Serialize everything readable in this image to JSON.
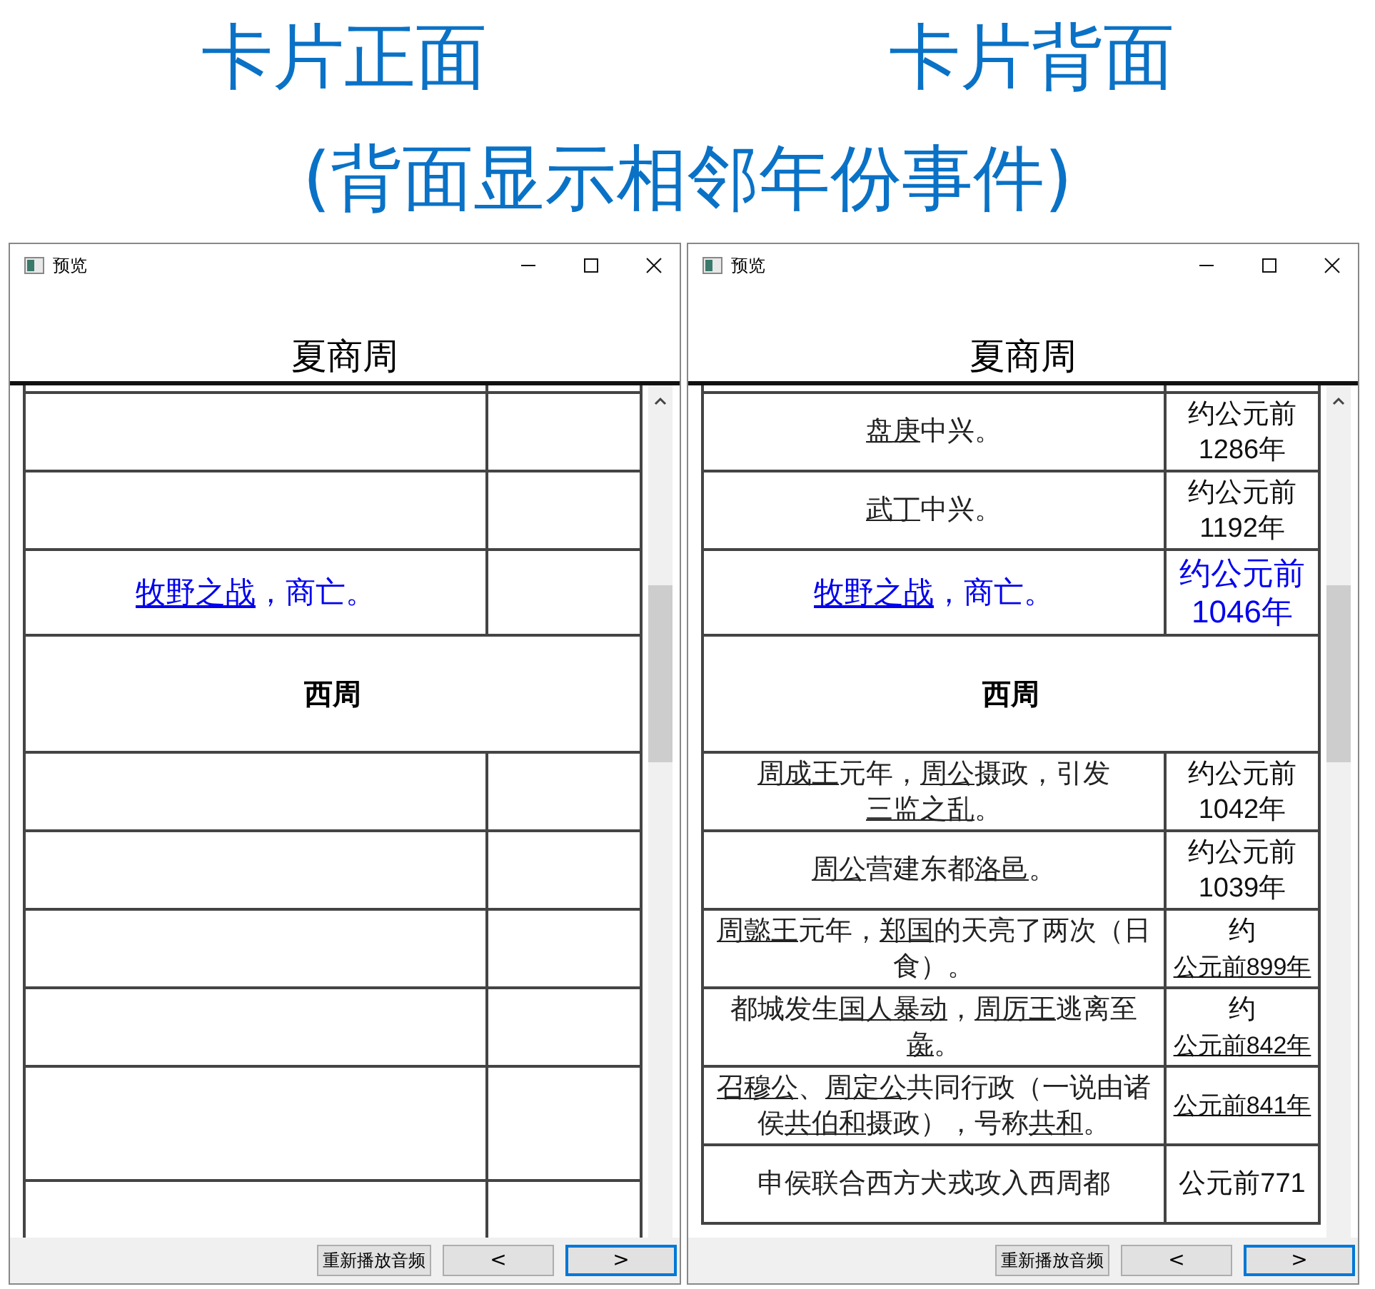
{
  "captions": {
    "front": "卡片正面",
    "back": "卡片背面",
    "note": "(背面显示相邻年份事件)"
  },
  "windows": [
    {
      "title": "预览",
      "heading": "夏商周",
      "rows": [
        {
          "kind": "blank"
        },
        {
          "kind": "blank"
        },
        {
          "kind": "event",
          "current": true,
          "event": [
            {
              "text": "牧野之战",
              "link": true
            },
            {
              "text": "，商亡。",
              "link": false
            }
          ]
        },
        {
          "kind": "period",
          "text": "西周"
        },
        {
          "kind": "blank"
        },
        {
          "kind": "blank"
        },
        {
          "kind": "blank"
        },
        {
          "kind": "blank"
        },
        {
          "kind": "blank",
          "tall": true
        },
        {
          "kind": "blank"
        }
      ],
      "buttons": {
        "replay": "重新播放音频",
        "prev": "<",
        "next": ">"
      }
    },
    {
      "title": "预览",
      "heading": "夏商周",
      "rows": [
        {
          "kind": "event",
          "current": false,
          "event": [
            {
              "text": "盘庚",
              "link": true
            },
            {
              "text": "中兴。",
              "link": false
            }
          ],
          "date": [
            {
              "text": "约公元前1286年",
              "link": false
            }
          ]
        },
        {
          "kind": "event",
          "current": false,
          "event": [
            {
              "text": "武丁",
              "link": true
            },
            {
              "text": "中兴。",
              "link": false
            }
          ],
          "date": [
            {
              "text": "约公元前1192年",
              "link": false
            }
          ]
        },
        {
          "kind": "event",
          "current": true,
          "event": [
            {
              "text": "牧野之战",
              "link": true
            },
            {
              "text": "，商亡。",
              "link": false
            }
          ],
          "date": [
            {
              "text": "约公元前1046年",
              "link": false
            }
          ]
        },
        {
          "kind": "period",
          "text": "西周"
        },
        {
          "kind": "event",
          "current": false,
          "event": [
            {
              "text": "周成王",
              "link": true
            },
            {
              "text": "元年，",
              "link": false
            },
            {
              "text": "周公",
              "link": true
            },
            {
              "text": "摄政，引发",
              "link": false
            },
            {
              "text": "三监之乱",
              "link": true
            },
            {
              "text": "。",
              "link": false
            }
          ],
          "date": [
            {
              "text": "约公元前1042年",
              "link": false
            }
          ]
        },
        {
          "kind": "event",
          "current": false,
          "event": [
            {
              "text": "周公",
              "link": true
            },
            {
              "text": "营建东都",
              "link": false
            },
            {
              "text": "洛邑",
              "link": true
            },
            {
              "text": "。",
              "link": false
            }
          ],
          "date": [
            {
              "text": "约公元前1039年",
              "link": false
            }
          ]
        },
        {
          "kind": "event",
          "current": false,
          "event": [
            {
              "text": "周懿王",
              "link": true
            },
            {
              "text": "元年，",
              "link": false
            },
            {
              "text": "郑国",
              "link": true
            },
            {
              "text": "的天亮了两次（日食）。",
              "link": false
            }
          ],
          "date": [
            {
              "text": "约",
              "link": false
            },
            {
              "text": "公元前899年",
              "link": true
            }
          ]
        },
        {
          "kind": "event",
          "current": false,
          "event": [
            {
              "text": "都城发生",
              "link": false
            },
            {
              "text": "国人暴动",
              "link": true
            },
            {
              "text": "，",
              "link": false
            },
            {
              "text": "周厉王",
              "link": true
            },
            {
              "text": "逃离至",
              "link": false
            },
            {
              "text": "彘",
              "link": true
            },
            {
              "text": "。",
              "link": false
            }
          ],
          "date": [
            {
              "text": "约",
              "link": false
            },
            {
              "text": "公元前842年",
              "link": true
            }
          ]
        },
        {
          "kind": "event",
          "current": false,
          "event": [
            {
              "text": "召穆公",
              "link": true
            },
            {
              "text": "、",
              "link": false
            },
            {
              "text": "周定公",
              "link": true
            },
            {
              "text": "共同行政（一说由诸侯",
              "link": false
            },
            {
              "text": "共伯和",
              "link": true
            },
            {
              "text": "摄政），号称",
              "link": false
            },
            {
              "text": "共和",
              "link": true
            },
            {
              "text": "。",
              "link": false
            }
          ],
          "date": [
            {
              "text": "公元前841年",
              "link": true
            }
          ]
        },
        {
          "kind": "event",
          "current": false,
          "event": [
            {
              "text": "申侯联合西方犬戎攻入西周都",
              "link": false
            }
          ],
          "date": [
            {
              "text": "公元前771",
              "link": false
            }
          ]
        }
      ],
      "buttons": {
        "replay": "重新播放音频",
        "prev": "<",
        "next": ">"
      }
    }
  ]
}
